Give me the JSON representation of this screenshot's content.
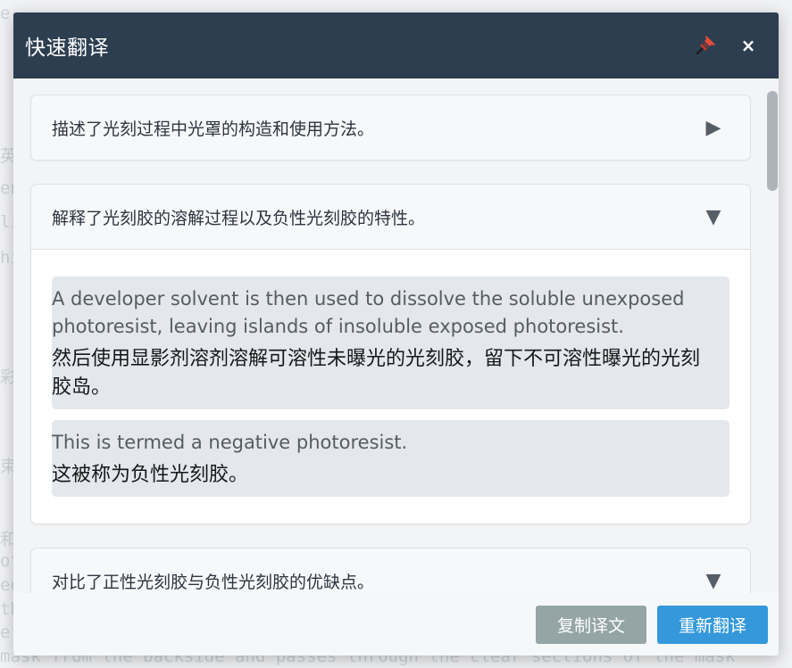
{
  "modal": {
    "title": "快速翻译",
    "pin_icon": "pushpin-icon",
    "close_icon": "close-icon",
    "close_label": "×"
  },
  "colors": {
    "header_bg": "#2c3e50",
    "copy_button": "#95a5a6",
    "retranslate_button": "#3498db"
  },
  "sections": [
    {
      "title": "描述了光刻过程中光罩的构造和使用方法。",
      "expanded": false,
      "toggle_glyph": "▶"
    },
    {
      "title": "解释了光刻胶的溶解过程以及负性光刻胶的特性。",
      "expanded": true,
      "toggle_glyph": "▼",
      "segments": [
        {
          "en": "A developer solvent is then used to dissolve the soluble unexposed photoresist, leaving islands of insoluble exposed photoresist.",
          "zh": "然后使用显影剂溶剂溶解可溶性未曝光的光刻胶，留下不可溶性曝光的光刻胶岛。"
        },
        {
          "en": "This is termed a negative photoresist.",
          "zh": "这被称为负性光刻胶。"
        }
      ]
    },
    {
      "title": "对比了正性光刻胶与负性光刻胶的优缺点。",
      "expanded": true,
      "toggle_glyph": "▼"
    }
  ],
  "footer": {
    "copy_label": "复制译文",
    "retranslate_label": "重新翻译"
  },
  "background_text": [
    "e",
    "英主",
    "end",
    "lie",
    "his",
    "彩端",
    "束 f",
    "和背景。>",
    "oto",
    "ed",
    "th",
    "e",
    "mask from the backside and passes through the clear sections of the mask"
  ]
}
